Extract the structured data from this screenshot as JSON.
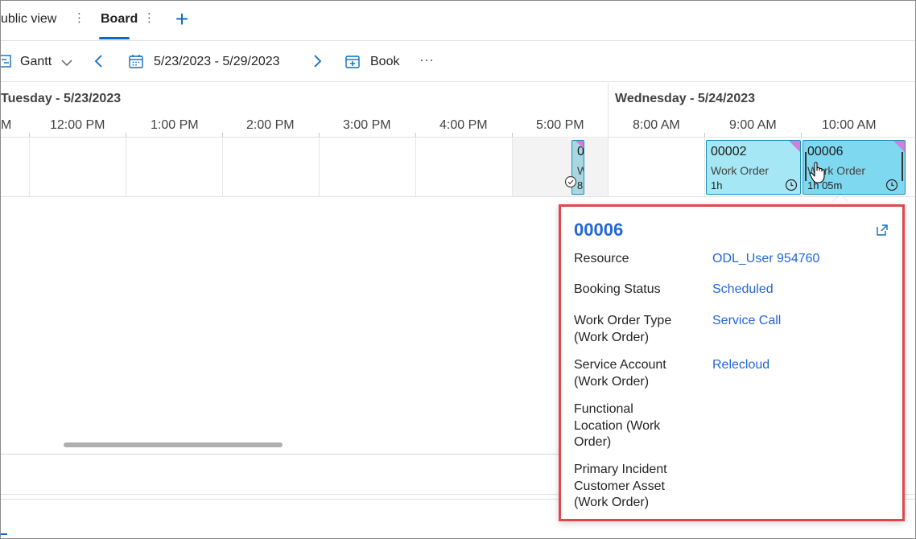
{
  "tabs": {
    "public_view_label": "ublic view",
    "board_label": "Board"
  },
  "toolbar": {
    "view_label": "Gantt",
    "date_range": "5/23/2023 - 5/29/2023",
    "book_label": "Book",
    "more_label": "···"
  },
  "schedule": {
    "days": [
      {
        "label": "Tuesday - 5/23/2023"
      },
      {
        "label": "Wednesday - 5/24/2023"
      }
    ],
    "hours": [
      "M",
      "12:00 PM",
      "1:00 PM",
      "2:00 PM",
      "3:00 PM",
      "4:00 PM",
      "5:00 PM",
      "8:00 AM",
      "9:00 AM",
      "10:00 AM"
    ]
  },
  "bookings": {
    "partial": {
      "id_fragment": "0",
      "type_fragment": "W",
      "dur_fragment": "8"
    },
    "b1": {
      "id": "00002",
      "type": "Work Order",
      "duration": "1h"
    },
    "b2": {
      "id": "00006",
      "type": "Work Order",
      "duration": "1h 05m"
    }
  },
  "popup": {
    "title": "00006",
    "fields": [
      {
        "label": "Resource",
        "value": "ODL_User 954760"
      },
      {
        "label": "Booking Status",
        "value": "Scheduled"
      },
      {
        "label": "Work Order Type (Work Order)",
        "value": "Service Call"
      },
      {
        "label": "Service Account (Work Order)",
        "value": "Relecloud"
      },
      {
        "label": "Functional Location (Work Order)",
        "value": ""
      },
      {
        "label": "Primary Incident Customer Asset (Work Order)",
        "value": ""
      }
    ]
  },
  "colors": {
    "accent": "#0f6cbd",
    "link": "#2266d6",
    "booking_fill": "#a6e7f5",
    "booking_selected_fill": "#7ed8ef",
    "highlight_border": "#e0474c",
    "status_corner": "#d07fe0"
  }
}
